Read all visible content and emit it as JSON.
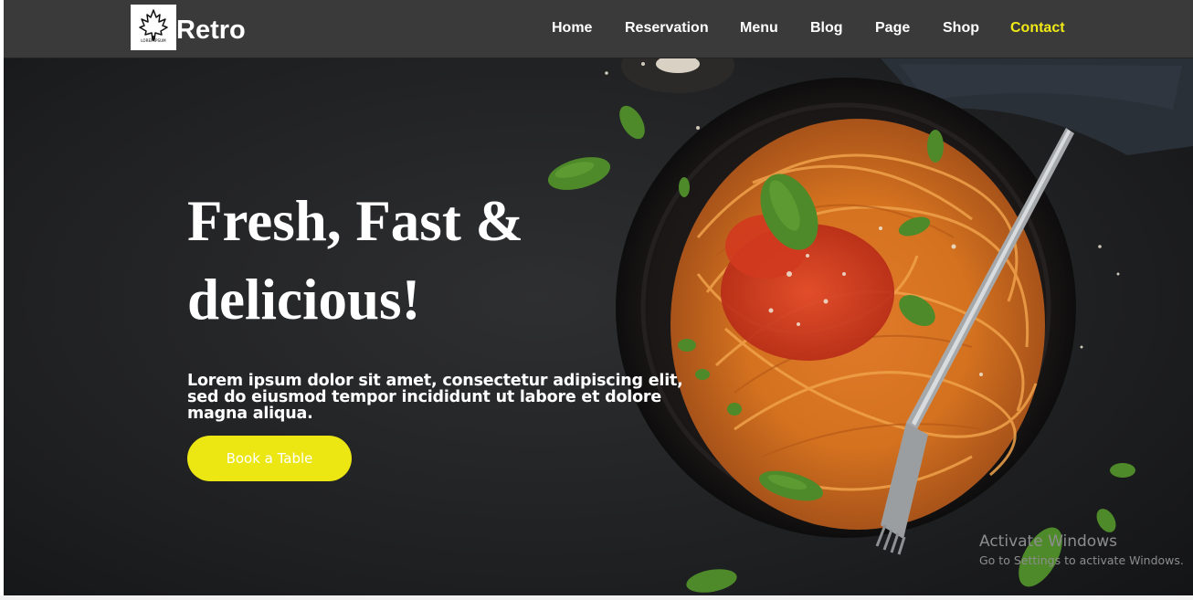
{
  "brand": {
    "name": "Retro",
    "logo_text": "LOREMIPSUM",
    "logo_icon": "maple-leaf-icon"
  },
  "nav": {
    "items": [
      {
        "label": "Home",
        "active": false
      },
      {
        "label": "Reservation",
        "active": false
      },
      {
        "label": "Menu",
        "active": false
      },
      {
        "label": "Blog",
        "active": false
      },
      {
        "label": "Page",
        "active": false
      },
      {
        "label": "Shop",
        "active": false
      },
      {
        "label": "Contact",
        "active": true
      }
    ]
  },
  "hero": {
    "headline_line1": "Fresh, Fast &",
    "headline_line2": "delicious!",
    "subtext": "Lorem ipsum dolor sit amet, consectetur adipiscing elit, sed do eiusmod tempor incididunt ut labore et dolore magna aliqua.",
    "cta_label": "Book a Table",
    "image": "spaghetti-plate-image"
  },
  "os_watermark": {
    "title": "Activate Windows",
    "subtitle": "Go to Settings to activate Windows."
  },
  "colors": {
    "navbar_bg": "#3a3a3a",
    "accent_yellow": "#ece613",
    "active_nav": "#f2ea17",
    "hero_bg": "#1b1c1d"
  }
}
